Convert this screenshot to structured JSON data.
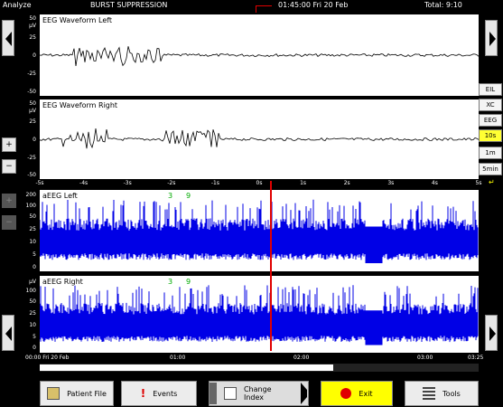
{
  "header": {
    "mode": "Analyze",
    "title": "BURST SUPPRESSION",
    "time": "01:45:00 Fri 20 Feb",
    "total": "Total: 9:10"
  },
  "eeg_left": {
    "title": "EEG Waveform Left",
    "y_ticks": [
      "50",
      "µV",
      "25",
      "0",
      "-25",
      "-50"
    ]
  },
  "eeg_right": {
    "title": "EEG Waveform Right",
    "y_ticks": [
      "50",
      "µV",
      "25",
      "0",
      "-25",
      "-50"
    ]
  },
  "x_axis": {
    "ticks": [
      "-5s",
      "-4s",
      "-3s",
      "-2s",
      "-1s",
      "0s",
      "1s",
      "2s",
      "3s",
      "4s",
      "5s"
    ]
  },
  "aeeg_left": {
    "title": "aEEG Left",
    "marks": [
      "3",
      "9"
    ],
    "y_ticks": [
      "200",
      "100",
      "50",
      "25",
      "10",
      "5",
      "0"
    ]
  },
  "aeeg_right": {
    "title": "aEEG Right",
    "marks": [
      "3",
      "9"
    ],
    "y_ticks": [
      "µV",
      "100",
      "50",
      "25",
      "10",
      "5",
      "0"
    ]
  },
  "time_axis": {
    "ticks": [
      "00:00 Fri 20 Feb",
      "01:00",
      "02:00",
      "03:00",
      "03:25"
    ]
  },
  "side_buttons": [
    "EIL",
    "XC",
    "EEG",
    "10s",
    "1m",
    "5min"
  ],
  "side_active": "10s",
  "footer": {
    "file": "Patient File",
    "events": "Events",
    "change_index": "Change Index",
    "exit": "Exit",
    "tools": "Tools"
  },
  "colors": {
    "trace": "#0000e6",
    "cursor": "#e00000",
    "active": "#ffff33",
    "exit": "#ffff00"
  }
}
